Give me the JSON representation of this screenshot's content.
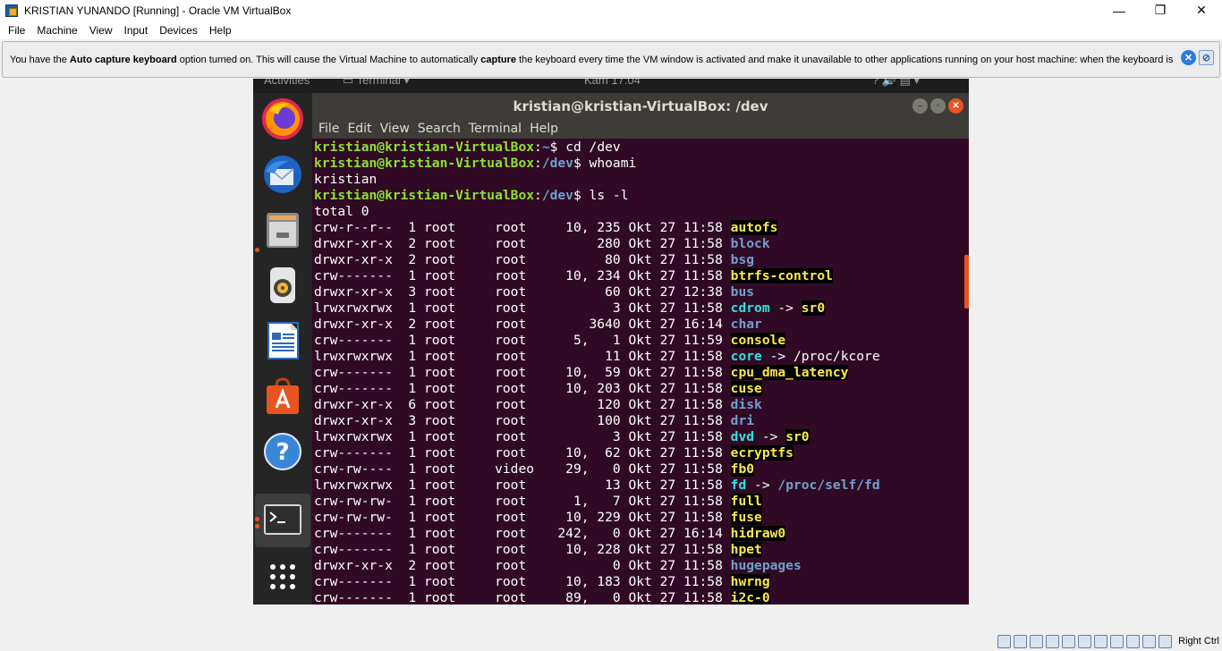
{
  "host": {
    "title": "KRISTIAN YUNANDO [Running] - Oracle VM VirtualBox",
    "win_buttons": [
      "—",
      "❐",
      "✕"
    ],
    "menu": [
      "File",
      "Machine",
      "View",
      "Input",
      "Devices",
      "Help"
    ]
  },
  "notification": {
    "part1": "You have the ",
    "bold1": "Auto capture keyboard",
    "part2": " option turned on. This will cause the Virtual Machine to automatically ",
    "bold2": "capture",
    "part3": " the keyboard every time the VM window is activated and make it unavailable to other applications running on your host machine: when the keyboard is",
    "icons": [
      "info-close-icon",
      "do-not-show-icon"
    ]
  },
  "gnome": {
    "activities": "Activities",
    "app_menu": "Terminal",
    "clock": "Kam 17:04"
  },
  "dock": {
    "items": [
      {
        "name": "firefox-icon"
      },
      {
        "name": "thunderbird-icon"
      },
      {
        "name": "files-icon"
      },
      {
        "name": "rhythmbox-icon"
      },
      {
        "name": "libreoffice-writer-icon"
      },
      {
        "name": "ubuntu-software-icon"
      },
      {
        "name": "help-icon"
      },
      {
        "name": "terminal-icon"
      },
      {
        "name": "show-applications-icon"
      }
    ]
  },
  "terminal": {
    "title": "kristian@kristian-VirtualBox: /dev",
    "menu": [
      "File",
      "Edit",
      "View",
      "Search",
      "Terminal",
      "Help"
    ],
    "prompt_user": "kristian@kristian-VirtualBox",
    "commands": [
      {
        "path": "~",
        "cmd": " cd /dev"
      },
      {
        "path": "/dev",
        "cmd": " whoami"
      }
    ],
    "whoami_output": "kristian",
    "ls_prompt": {
      "path": "/dev",
      "cmd": " ls -l"
    },
    "total": "total 0",
    "entries": [
      {
        "meta": "crw-r--r--  1 root     root     10, 235 Okt 27 11:58 ",
        "name": "autofs",
        "type": "chr"
      },
      {
        "meta": "drwxr-xr-x  2 root     root         280 Okt 27 11:58 ",
        "name": "block",
        "type": "dir"
      },
      {
        "meta": "drwxr-xr-x  2 root     root          80 Okt 27 11:58 ",
        "name": "bsg",
        "type": "dir"
      },
      {
        "meta": "crw-------  1 root     root     10, 234 Okt 27 11:58 ",
        "name": "btrfs-control",
        "type": "chr"
      },
      {
        "meta": "drwxr-xr-x  3 root     root          60 Okt 27 12:38 ",
        "name": "bus",
        "type": "dir"
      },
      {
        "meta": "lrwxrwxrwx  1 root     root           3 Okt 27 11:58 ",
        "name": "cdrom",
        "type": "lnk",
        "arrow": " -> ",
        "target": "sr0",
        "target_type": "chr"
      },
      {
        "meta": "drwxr-xr-x  2 root     root        3640 Okt 27 16:14 ",
        "name": "char",
        "type": "dir"
      },
      {
        "meta": "crw-------  1 root     root      5,   1 Okt 27 11:59 ",
        "name": "console",
        "type": "chr"
      },
      {
        "meta": "lrwxrwxrwx  1 root     root          11 Okt 27 11:58 ",
        "name": "core",
        "type": "lnk",
        "arrow": " -> ",
        "target": "/proc/kcore",
        "target_type": "plain"
      },
      {
        "meta": "crw-------  1 root     root     10,  59 Okt 27 11:58 ",
        "name": "cpu_dma_latency",
        "type": "chr"
      },
      {
        "meta": "crw-------  1 root     root     10, 203 Okt 27 11:58 ",
        "name": "cuse",
        "type": "chr"
      },
      {
        "meta": "drwxr-xr-x  6 root     root         120 Okt 27 11:58 ",
        "name": "disk",
        "type": "dir"
      },
      {
        "meta": "drwxr-xr-x  3 root     root         100 Okt 27 11:58 ",
        "name": "dri",
        "type": "dir"
      },
      {
        "meta": "lrwxrwxrwx  1 root     root           3 Okt 27 11:58 ",
        "name": "dvd",
        "type": "lnk",
        "arrow": " -> ",
        "target": "sr0",
        "target_type": "chr"
      },
      {
        "meta": "crw-------  1 root     root     10,  62 Okt 27 11:58 ",
        "name": "ecryptfs",
        "type": "chr"
      },
      {
        "meta": "crw-rw----  1 root     video    29,   0 Okt 27 11:58 ",
        "name": "fb0",
        "type": "chr"
      },
      {
        "meta": "lrwxrwxrwx  1 root     root          13 Okt 27 11:58 ",
        "name": "fd",
        "type": "lnk",
        "arrow": " -> ",
        "target": "/proc/self/fd",
        "target_type": "dir"
      },
      {
        "meta": "crw-rw-rw-  1 root     root      1,   7 Okt 27 11:58 ",
        "name": "full",
        "type": "chr"
      },
      {
        "meta": "crw-rw-rw-  1 root     root     10, 229 Okt 27 11:58 ",
        "name": "fuse",
        "type": "chr"
      },
      {
        "meta": "crw-------  1 root     root    242,   0 Okt 27 16:14 ",
        "name": "hidraw0",
        "type": "chr"
      },
      {
        "meta": "crw-------  1 root     root     10, 228 Okt 27 11:58 ",
        "name": "hpet",
        "type": "chr"
      },
      {
        "meta": "drwxr-xr-x  2 root     root           0 Okt 27 11:58 ",
        "name": "hugepages",
        "type": "dir"
      },
      {
        "meta": "crw-------  1 root     root     10, 183 Okt 27 11:58 ",
        "name": "hwrng",
        "type": "chr"
      },
      {
        "meta": "crw-------  1 root     root     89,   0 Okt 27 11:58 ",
        "name": "i2c-0",
        "type": "chr"
      }
    ]
  },
  "status": {
    "host_key": "Right Ctrl",
    "icons": [
      "hard-disk-icon",
      "optical-drive-icon",
      "audio-icon",
      "network-icon",
      "usb-icon",
      "shared-folders-icon",
      "display-icon",
      "video-capture-icon",
      "cpu-icon",
      "mouse-integration-icon",
      "keyboard-capture-icon"
    ]
  },
  "colors": {
    "terminal_bg": "#300a24",
    "prompt_user": "#8ae234",
    "prompt_path": "#729fcf",
    "char_device": "#fce94f",
    "link": "#34e2e2",
    "ubuntu_orange": "#e95420"
  }
}
